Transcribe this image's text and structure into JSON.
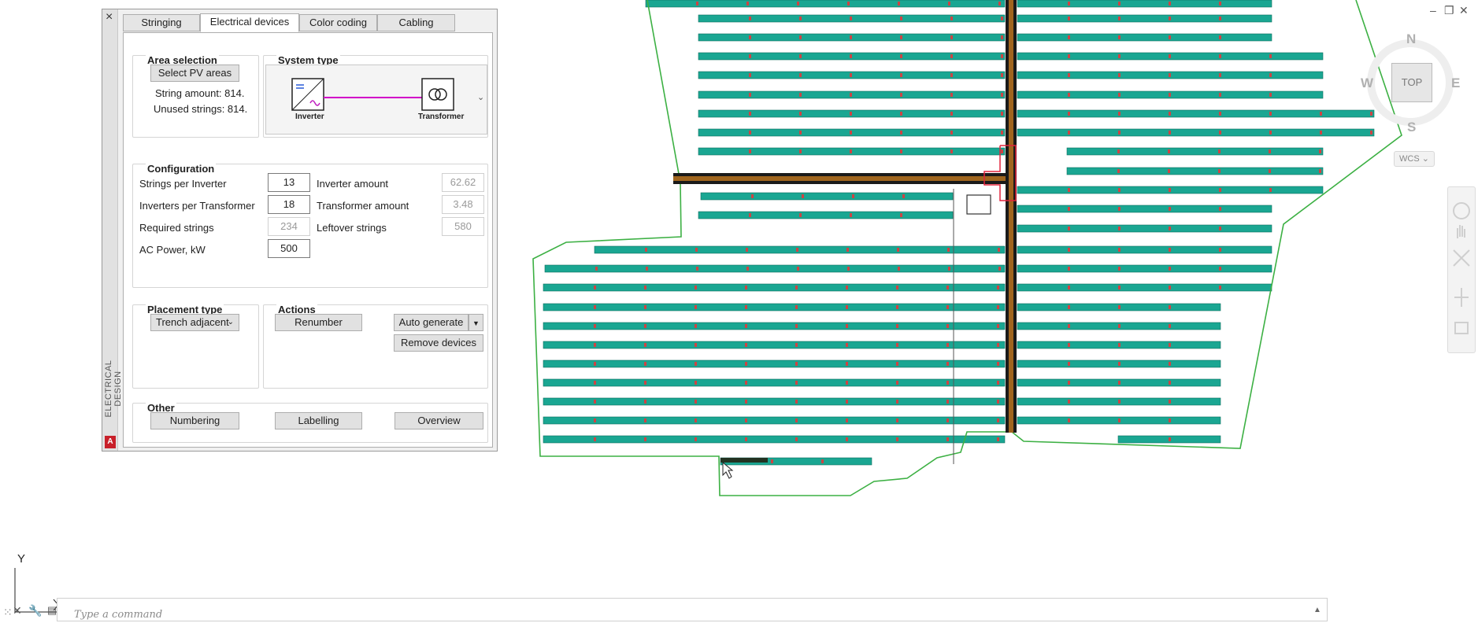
{
  "palette": {
    "vertical_title": "ELECTRICAL DESIGN",
    "close_symbol": "×",
    "badge": "A",
    "tabs": [
      {
        "label": "Stringing",
        "active": false
      },
      {
        "label": "Electrical devices",
        "active": true
      },
      {
        "label": "Color coding",
        "active": false
      },
      {
        "label": "Cabling",
        "active": false
      }
    ],
    "area_selection": {
      "title": "Area selection",
      "select_button": "Select PV areas",
      "string_amount": "String amount: 814.",
      "unused_strings": "Unused strings: 814."
    },
    "system_type": {
      "title": "System type",
      "inverter_label": "Inverter",
      "transformer_label": "Transformer",
      "dropdown_glyph": "⌄"
    },
    "configuration": {
      "title": "Configuration",
      "strings_per_inverter_label": "Strings per Inverter",
      "strings_per_inverter_value": "13",
      "inverters_per_transformer_label": "Inverters per Transformer",
      "inverters_per_transformer_value": "18",
      "required_strings_label": "Required strings",
      "required_strings_value": "234",
      "ac_power_label": "AC Power, kW",
      "ac_power_value": "500",
      "inverter_amount_label": "Inverter amount",
      "inverter_amount_value": "62.62",
      "transformer_amount_label": "Transformer amount",
      "transformer_amount_value": "3.48",
      "leftover_strings_label": "Leftover strings",
      "leftover_strings_value": "580"
    },
    "placement": {
      "title": "Placement type",
      "selected": "Trench adjacent"
    },
    "actions": {
      "title": "Actions",
      "renumber": "Renumber",
      "auto_generate": "Auto generate",
      "remove_devices": "Remove devices"
    },
    "other": {
      "title": "Other",
      "numbering": "Numbering",
      "labelling": "Labelling",
      "overview": "Overview"
    }
  },
  "viewcube": {
    "north": "N",
    "south": "S",
    "east": "E",
    "west": "W",
    "face": "TOP",
    "wcs": "WCS ⌄"
  },
  "ucs": {
    "y_label": "Y"
  },
  "command_line": {
    "placeholder": "Type a command"
  },
  "colors": {
    "boundary": "#3cb043",
    "pv_row": "#1aa692",
    "trench_outer": "#1a1a1a",
    "trench_inner": "#a0651e",
    "magenta_link": "#d100c8",
    "red_outline": "#e2233b"
  }
}
